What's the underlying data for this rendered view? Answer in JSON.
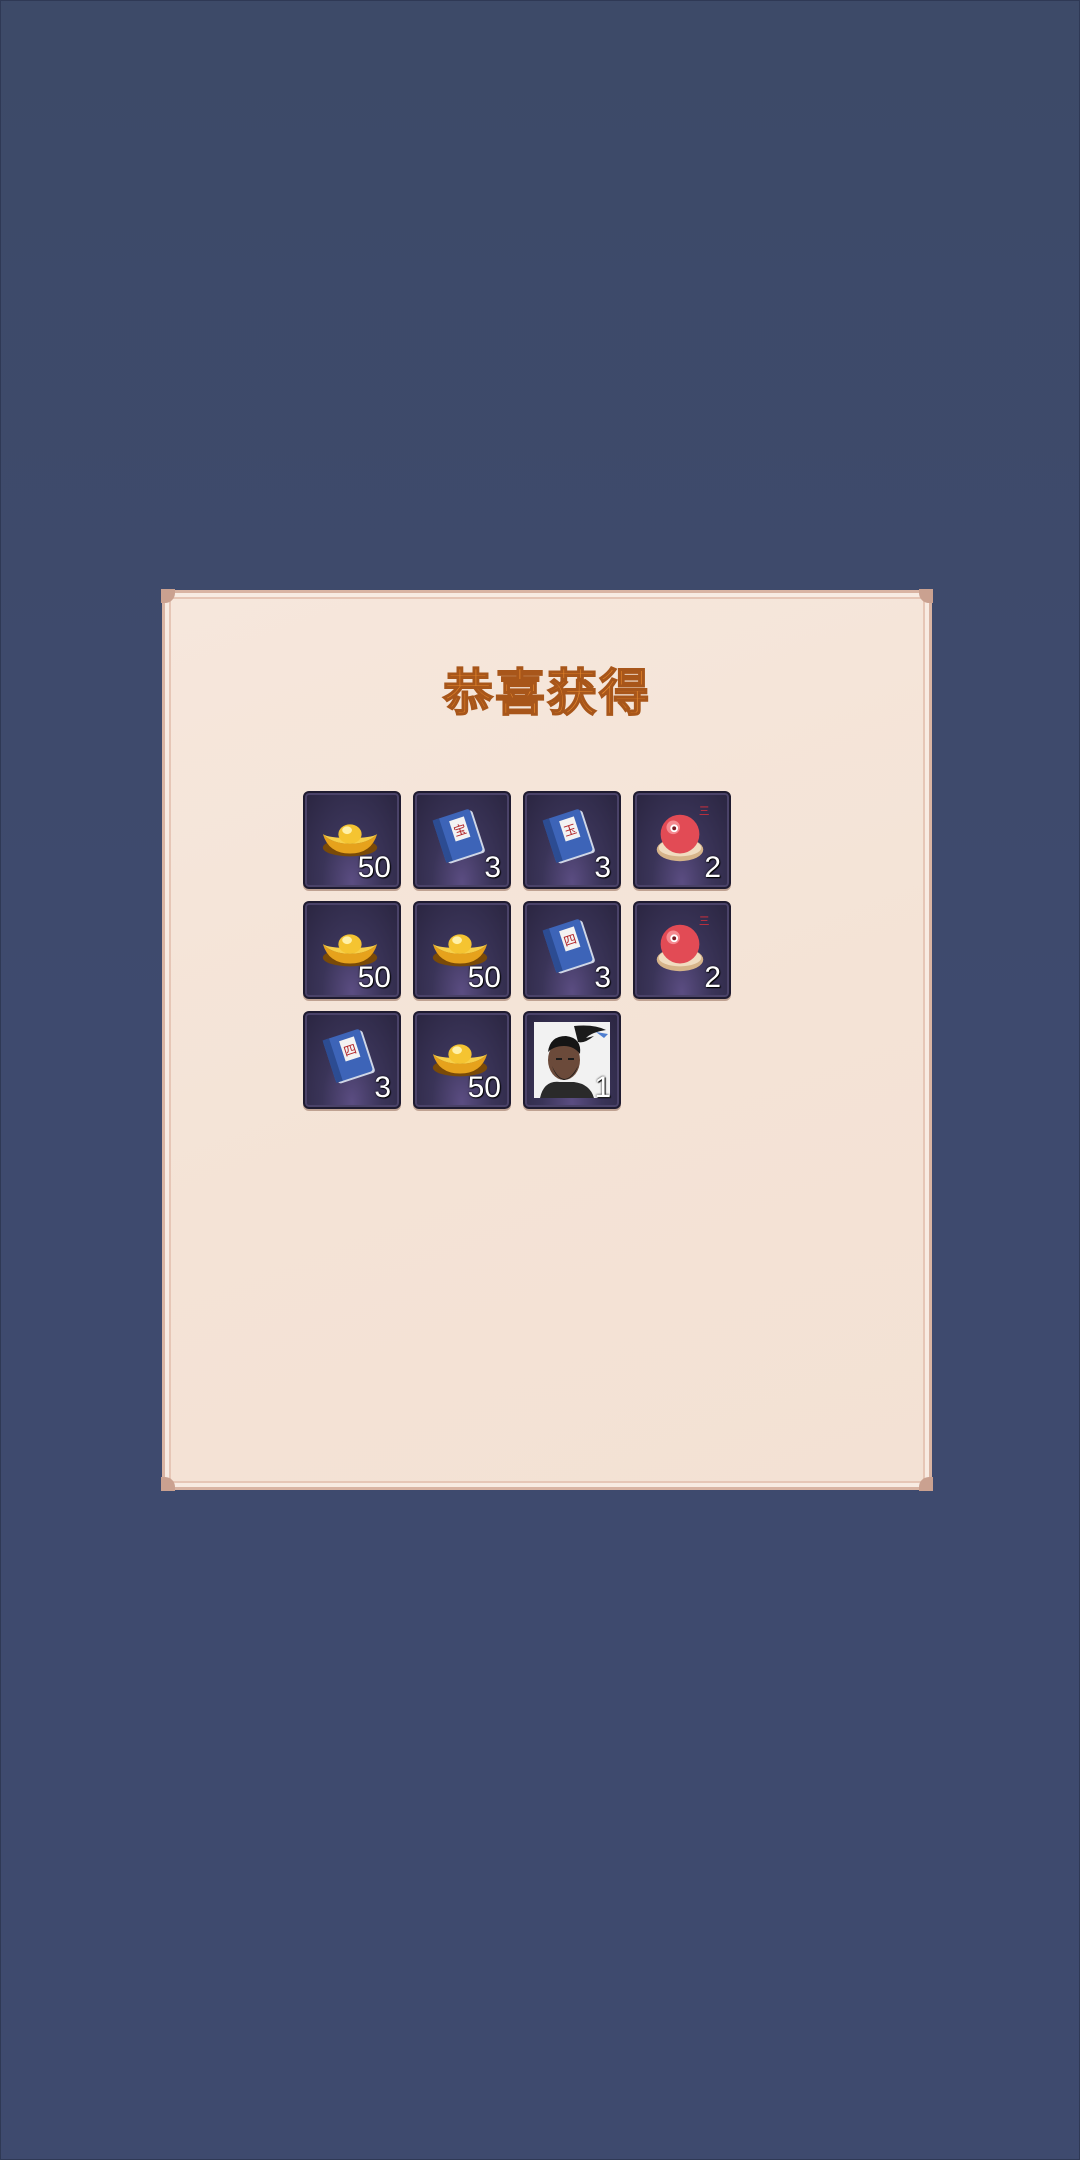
{
  "dialog": {
    "title": "恭喜获得"
  },
  "rewards": [
    {
      "item": "gold-ingot",
      "icon": "gold-ingot-icon",
      "count": "50"
    },
    {
      "item": "blue-book",
      "icon": "skill-book-icon",
      "count": "3",
      "book_label": "宝"
    },
    {
      "item": "blue-book",
      "icon": "skill-book-icon",
      "count": "3",
      "book_label": "玉"
    },
    {
      "item": "peach-bun",
      "icon": "peach-bun-icon",
      "count": "2",
      "tag": "三"
    },
    {
      "item": "gold-ingot",
      "icon": "gold-ingot-icon",
      "count": "50"
    },
    {
      "item": "gold-ingot",
      "icon": "gold-ingot-icon",
      "count": "50"
    },
    {
      "item": "blue-book",
      "icon": "skill-book-icon",
      "count": "3",
      "book_label": "四"
    },
    {
      "item": "peach-bun",
      "icon": "peach-bun-icon",
      "count": "2",
      "tag": "三"
    },
    {
      "item": "blue-book",
      "icon": "skill-book-icon",
      "count": "3",
      "book_label": "四"
    },
    {
      "item": "gold-ingot",
      "icon": "gold-ingot-icon",
      "count": "50"
    },
    {
      "item": "hero-portrait",
      "icon": "hero-portrait-icon",
      "count": "1"
    }
  ],
  "colors": {
    "background": "#3e4a6e",
    "panel": "#f5e5d9",
    "title": "#e8892e",
    "slot": "#3a3458"
  }
}
